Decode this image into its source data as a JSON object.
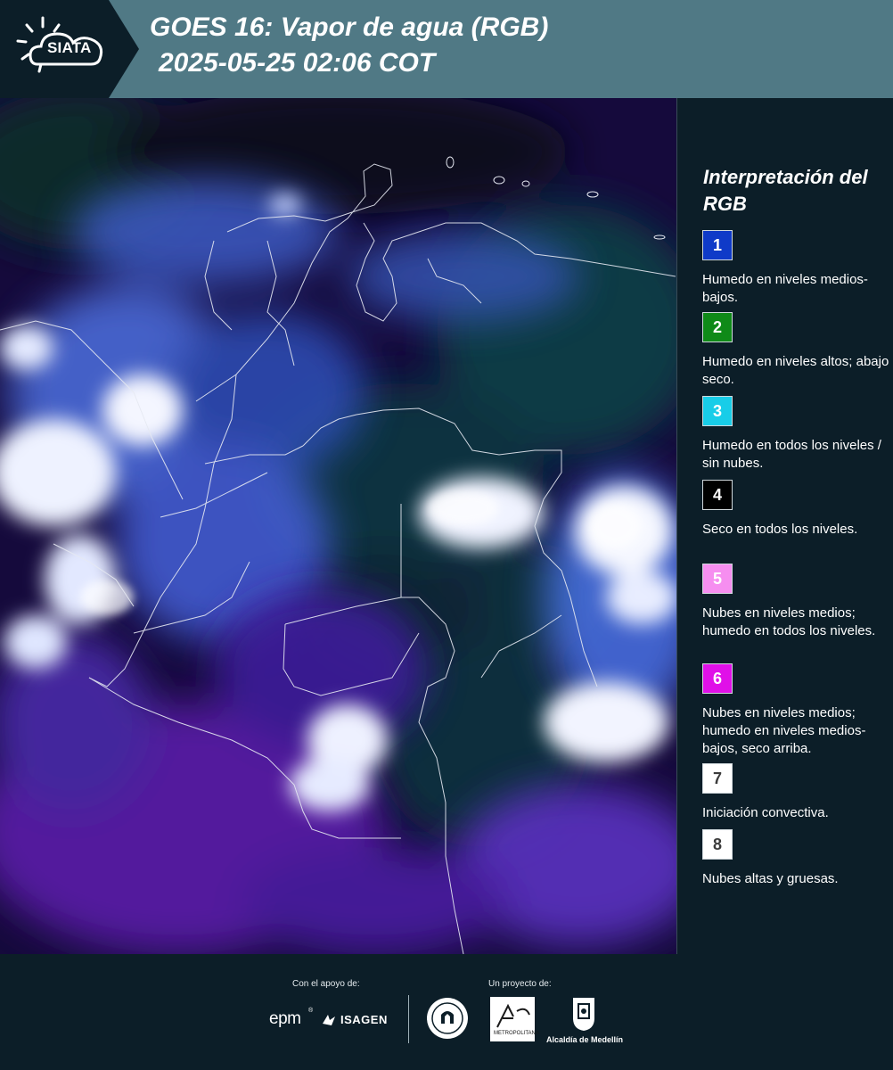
{
  "header": {
    "logo_text": "SIATA",
    "title_line1": "GOES 16: Vapor de agua (RGB)",
    "title_line2": "2025-05-25 02:06 COT",
    "background_color": "#507985"
  },
  "legend": {
    "title": "Interpretación del RGB",
    "items": [
      {
        "number": "1",
        "color": "#0f3ac8",
        "number_color": "#ffffff",
        "description": "Humedo en niveles medios-bajos."
      },
      {
        "number": "2",
        "color": "#0f8a18",
        "number_color": "#ffffff",
        "description": "Humedo en niveles altos; abajo seco."
      },
      {
        "number": "3",
        "color": "#18cde8",
        "number_color": "#ffffff",
        "description": "Humedo en todos los niveles / sin nubes."
      },
      {
        "number": "4",
        "color": "#000000",
        "number_color": "#ffffff",
        "description": "Seco en todos los niveles."
      },
      {
        "number": "5",
        "color": "#f68ef0",
        "number_color": "#ffffff",
        "description": "Nubes en niveles medios; humedo en todos los niveles."
      },
      {
        "number": "6",
        "color": "#e010e8",
        "number_color": "#ffffff",
        "description": "Nubes en niveles medios; humedo en niveles medios-bajos, seco arriba."
      },
      {
        "number": "7",
        "color": "#ffffff",
        "number_color": "#3b3b3b",
        "description": "Iniciación convectiva."
      },
      {
        "number": "8",
        "color": "#ffffff",
        "number_color": "#3b3b3b",
        "description": "Nubes altas y gruesas."
      }
    ]
  },
  "footer": {
    "support_caption": "Con el apoyo de:",
    "project_caption": "Un proyecto de:",
    "sponsors": [
      "epm",
      "ISAGEN"
    ],
    "epm_mark": "®",
    "partners": [
      "Área Metropolitana",
      "Alcaldía de Medellín"
    ],
    "area_caption": "METROPOLITANA",
    "alcaldia_caption": "Alcaldía de Medellín"
  }
}
